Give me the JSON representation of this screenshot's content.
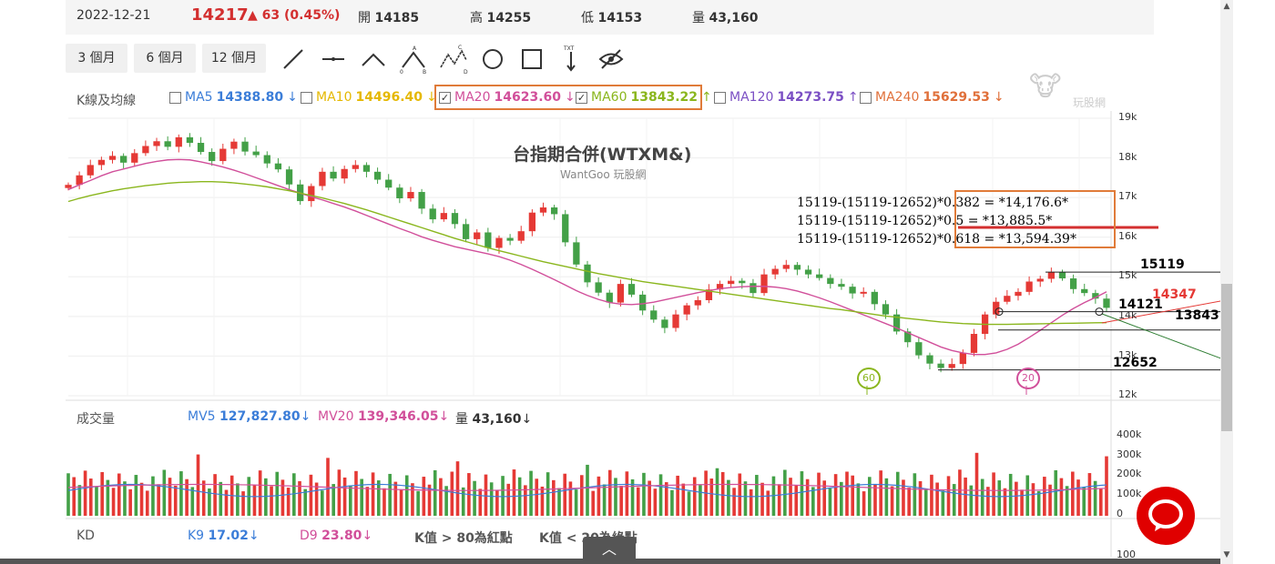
{
  "header": {
    "date": "2022-12-21",
    "price": "14217",
    "change": "▲ 63 (0.45%)",
    "open_label": "開",
    "open": "14185",
    "high_label": "高",
    "high": "14255",
    "low_label": "低",
    "low": "14153",
    "vol_label": "量",
    "vol": "43,160"
  },
  "periods": [
    "3 個月",
    "6 個月",
    "12 個月"
  ],
  "tools": [
    "line-tool-icon",
    "horizontal-line-icon",
    "polyline-icon",
    "abc-pattern-icon",
    "abcd-pattern-icon",
    "circle-icon",
    "rectangle-icon",
    "text-marker-icon",
    "hide-eye-icon"
  ],
  "ma_bar": {
    "title": "K線及均線",
    "items": [
      {
        "label": "MA5",
        "value": "14388.80",
        "arrow": "↓",
        "color": "#3b7dd8",
        "checked": false
      },
      {
        "label": "MA10",
        "value": "14496.40",
        "arrow": "↓",
        "color": "#e5b800",
        "checked": false
      },
      {
        "label": "MA20",
        "value": "14623.60",
        "arrow": "↓",
        "color": "#d14f9a",
        "checked": true
      },
      {
        "label": "MA60",
        "value": "13843.22",
        "arrow": "↑",
        "color": "#8ab61d",
        "checked": true
      },
      {
        "label": "MA120",
        "value": "14273.75",
        "arrow": "↑",
        "color": "#7b4fc4",
        "checked": false
      },
      {
        "label": "MA240",
        "value": "15629.53",
        "arrow": "↓",
        "color": "#e0703a",
        "checked": false
      }
    ]
  },
  "watermark": "玩股網",
  "chart_title": "台指期合併(WTXM&)",
  "chart_subtitle": "WantGoo 玩股網",
  "price_axis": [
    "19k",
    "18k",
    "17k",
    "16k",
    "15k",
    "14k",
    "13k",
    "12k"
  ],
  "fib_lines": [
    "15119-(15119-12652)*0.382 = *14,176.6*",
    "15119-(15119-12652)*0.5 = *13,885.5*",
    "15119-(15119-12652)*0.618 = *13,594.39*"
  ],
  "levels": {
    "high": "15119",
    "now": "14347",
    "l1": "14121",
    "ma60": "13843",
    "low": "12652"
  },
  "markers": {
    "ma60": "60",
    "ma20": "20"
  },
  "volume_bar": {
    "title": "成交量",
    "mv5_label": "MV5",
    "mv5": "127,827.80",
    "mv5_arrow": "↓",
    "mv20_label": "MV20",
    "mv20": "139,346.05",
    "mv20_arrow": "↓",
    "vol_label": "量",
    "vol": "43,160",
    "vol_arrow": "↓"
  },
  "volume_axis": [
    "400k",
    "300k",
    "200k",
    "100k",
    "0"
  ],
  "kd_bar": {
    "title": "KD",
    "k_label": "K9",
    "k": "17.02",
    "k_arrow": "↓",
    "d_label": "D9",
    "d": "23.80",
    "d_arrow": "↓",
    "note1": "K值 > 80為紅點",
    "note2": "K值 < 20為綠點"
  },
  "kd_axis": "100",
  "colors": {
    "up": "#e53935",
    "down": "#43a047",
    "ma20": "#d14f9a",
    "ma60": "#8ab61d",
    "fib_box": "#e07b39",
    "accent": "#d32f2f"
  },
  "chart_data": {
    "type": "candlestick",
    "title": "台指期合併(WTXM&)",
    "ylim": [
      12000,
      19000
    ],
    "close": [
      17320,
      17560,
      17820,
      17950,
      18050,
      17880,
      18120,
      18300,
      18420,
      18280,
      18520,
      18380,
      18150,
      17920,
      18230,
      18410,
      18160,
      18070,
      17860,
      17710,
      17330,
      16910,
      17290,
      17650,
      17480,
      17720,
      17820,
      17650,
      17450,
      17250,
      16980,
      17140,
      16720,
      16450,
      16610,
      16330,
      15950,
      16120,
      15730,
      15980,
      15910,
      16150,
      16620,
      16750,
      16580,
      15870,
      15310,
      14860,
      14600,
      14350,
      14820,
      14550,
      14150,
      13920,
      13710,
      14050,
      14280,
      14410,
      14680,
      14820,
      14900,
      14840,
      14590,
      15060,
      15200,
      15300,
      15180,
      15060,
      14970,
      14820,
      14750,
      14580,
      14620,
      14310,
      14050,
      13620,
      13350,
      13020,
      12810,
      12700,
      12800,
      13080,
      13560,
      14050,
      14370,
      14520,
      14620,
      14880,
      14950,
      15120,
      14960,
      14690,
      14590,
      14450,
      14217
    ],
    "ma20": [
      17200,
      17320,
      17430,
      17550,
      17650,
      17720,
      17790,
      17860,
      17910,
      17950,
      17960,
      17950,
      17900,
      17840,
      17770,
      17690,
      17600,
      17500,
      17400,
      17300,
      17200,
      17110,
      17020,
      16940,
      16850,
      16760,
      16660,
      16550,
      16440,
      16330,
      16220,
      16120,
      16010,
      15920,
      15840,
      15760,
      15700,
      15640,
      15580,
      15510,
      15420,
      15310,
      15190,
      15060,
      14930,
      14790,
      14650,
      14530,
      14430,
      14350,
      14310,
      14300,
      14320,
      14360,
      14420,
      14480,
      14540,
      14600,
      14650,
      14700,
      14730,
      14750,
      14760,
      14760,
      14740,
      14700,
      14640,
      14560,
      14470,
      14370,
      14260,
      14150,
      14040,
      13930,
      13820,
      13710,
      13590,
      13470,
      13350,
      13230,
      13140,
      13080,
      13040,
      13040,
      13080,
      13170,
      13300,
      13470,
      13650,
      13840,
      14030,
      14200,
      14350,
      14480,
      14623
    ],
    "ma60": [
      16900,
      16980,
      17050,
      17110,
      17170,
      17220,
      17260,
      17300,
      17330,
      17360,
      17380,
      17390,
      17400,
      17400,
      17390,
      17370,
      17340,
      17310,
      17270,
      17220,
      17170,
      17110,
      17050,
      16990,
      16920,
      16850,
      16770,
      16690,
      16600,
      16510,
      16420,
      16330,
      16240,
      16150,
      16060,
      15970,
      15890,
      15810,
      15730,
      15660,
      15590,
      15520,
      15450,
      15380,
      15320,
      15260,
      15200,
      15140,
      15080,
      15030,
      14980,
      14930,
      14880,
      14840,
      14800,
      14760,
      14720,
      14680,
      14640,
      14600,
      14560,
      14520,
      14480,
      14440,
      14400,
      14360,
      14320,
      14280,
      14240,
      14200,
      14170,
      14130,
      14090,
      14050,
      14010,
      13980,
      13950,
      13920,
      13890,
      13860,
      13840,
      13820,
      13810,
      13800,
      13800,
      13800,
      13805,
      13810,
      13815,
      13820,
      13825,
      13830,
      13835,
      13840,
      13843
    ]
  }
}
